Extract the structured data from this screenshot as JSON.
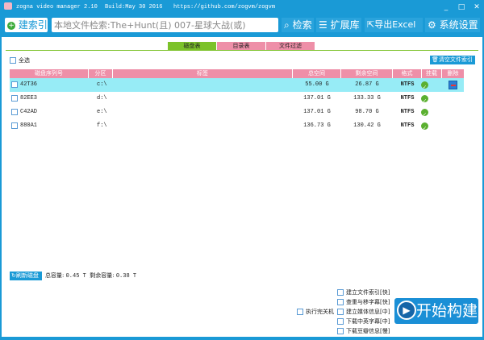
{
  "titlebar": {
    "app": "zogna video manager 2.10",
    "build": "Build:May 30 2016",
    "url": "https://github.com/zogvm/zogvm"
  },
  "toolbar": {
    "build_index": "建索引",
    "search_value": "本地文件检索:The+Hunt(且) 007-星球大战(或)",
    "search": "检索",
    "extensions": "扩展库",
    "export": "导出Excel",
    "settings": "系统设置"
  },
  "tabs": [
    {
      "label": "磁盘表",
      "color": "#7cc22a"
    },
    {
      "label": "目录表",
      "color": "#ee8fa8"
    },
    {
      "label": "文件过滤",
      "color": "#ee8fa8"
    }
  ],
  "select_all": "全选",
  "clear_index": "清空文件索引",
  "columns": [
    "磁盘序列号",
    "分区",
    "标签",
    "总空间",
    "剩余空间",
    "格式",
    "挂载",
    "删除"
  ],
  "rows": [
    {
      "serial": "42T36",
      "partition": "c:\\",
      "label": "",
      "total": "55.00 G",
      "free": "26.87 G",
      "format": "NTFS",
      "mounted": true,
      "selected": true
    },
    {
      "serial": "82EE3",
      "partition": "d:\\",
      "label": "",
      "total": "137.01 G",
      "free": "133.33 G",
      "format": "NTFS",
      "mounted": true
    },
    {
      "serial": "C42AD",
      "partition": "e:\\",
      "label": "",
      "total": "137.01 G",
      "free": "98.70 G",
      "format": "NTFS",
      "mounted": true
    },
    {
      "serial": "880A1",
      "partition": "f:\\",
      "label": "",
      "total": "136.73 G",
      "free": "130.42 G",
      "format": "NTFS",
      "mounted": true
    }
  ],
  "footer": {
    "refresh": "刷新磁盘",
    "total_label": "总容量:",
    "total": "0.45 T",
    "free_label": "剩余容量:",
    "free": "0.38 T"
  },
  "options": [
    "建立文件索引[快]",
    "查重与移字幕[快]",
    "建立媒体信息[中]",
    "下载中英字幕[中]",
    "下载豆瓣信息[慢]"
  ],
  "shutdown": "执行完关机",
  "start": "开始构建"
}
